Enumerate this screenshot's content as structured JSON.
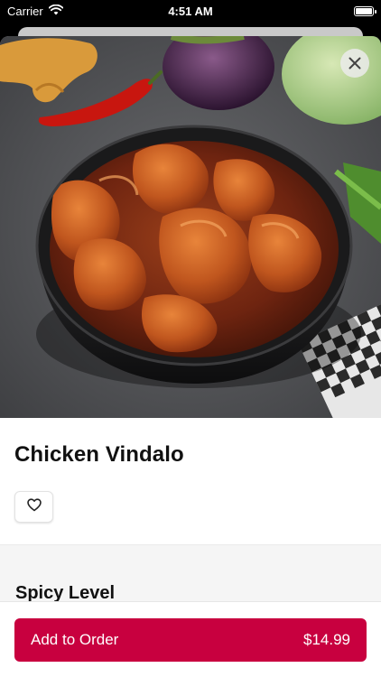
{
  "status_bar": {
    "carrier": "Carrier",
    "time": "4:51 AM"
  },
  "item": {
    "name": "Chicken Vindalo",
    "image_alt": "chicken-vindaloo-bowl"
  },
  "sections": {
    "spicy_level_title": "Spicy Level"
  },
  "order_button": {
    "label": "Add to Order",
    "price": "$14.99"
  },
  "colors": {
    "accent": "#c8003f",
    "sheet_background": "#ffffff",
    "band_background": "#f5f5f5"
  },
  "icons": {
    "close": "close-icon",
    "favorite": "heart-outline-icon",
    "wifi": "wifi-icon",
    "battery": "battery-icon"
  }
}
